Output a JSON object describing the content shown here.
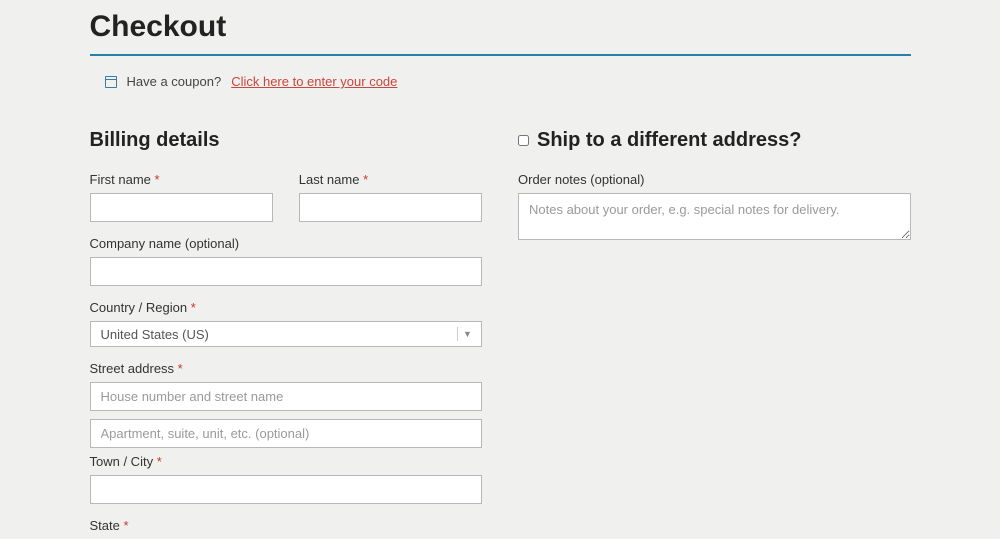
{
  "page": {
    "title": "Checkout"
  },
  "coupon": {
    "prompt": "Have a coupon?",
    "link_text": "Click here to enter your code"
  },
  "billing": {
    "heading": "Billing details",
    "first_name_label": "First name",
    "last_name_label": "Last name",
    "company_label": "Company name (optional)",
    "country_label": "Country / Region",
    "country_value": "United States (US)",
    "street_label": "Street address",
    "street1_placeholder": "House number and street name",
    "street2_placeholder": "Apartment, suite, unit, etc. (optional)",
    "city_label": "Town / City",
    "state_label": "State"
  },
  "shipping": {
    "heading": "Ship to a different address?",
    "notes_label": "Order notes (optional)",
    "notes_placeholder": "Notes about your order, e.g. special notes for delivery."
  },
  "required_mark": "*"
}
